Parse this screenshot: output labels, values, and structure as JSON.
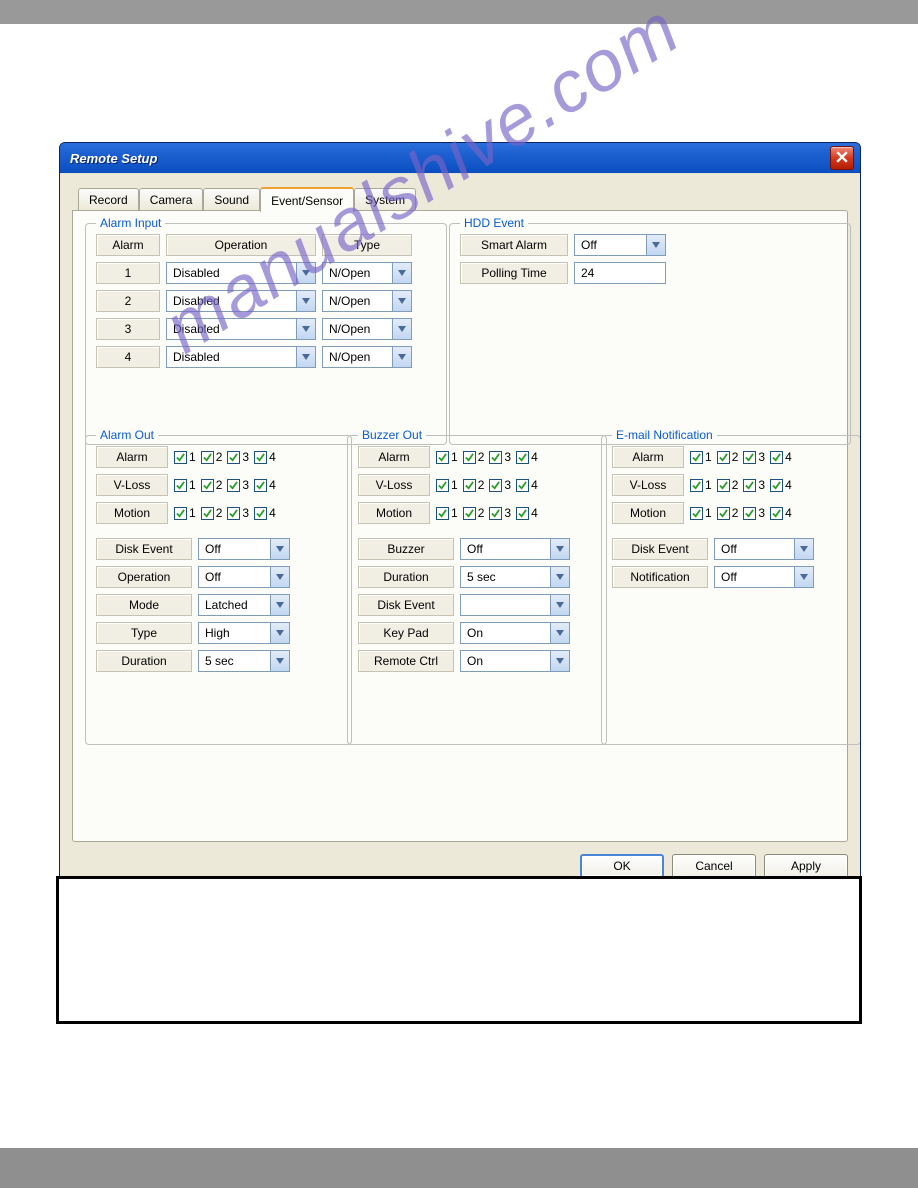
{
  "window": {
    "title": "Remote Setup"
  },
  "tabs": {
    "t0": "Record",
    "t1": "Camera",
    "t2": "Sound",
    "t3": "Event/Sensor",
    "t4": "System"
  },
  "alarm_input": {
    "legend": "Alarm Input",
    "hdr_alarm": "Alarm",
    "hdr_operation": "Operation",
    "hdr_type": "Type",
    "rows": {
      "r1": {
        "num": "1",
        "op": "Disabled",
        "type": "N/Open"
      },
      "r2": {
        "num": "2",
        "op": "Disabled",
        "type": "N/Open"
      },
      "r3": {
        "num": "3",
        "op": "Disabled",
        "type": "N/Open"
      },
      "r4": {
        "num": "4",
        "op": "Disabled",
        "type": "N/Open"
      }
    }
  },
  "hdd_event": {
    "legend": "HDD Event",
    "lbl_smart": "Smart Alarm",
    "val_smart": "Off",
    "lbl_polling": "Polling Time",
    "val_polling": "24"
  },
  "checkbox_labels": {
    "n1": "1",
    "n2": "2",
    "n3": "3",
    "n4": "4"
  },
  "shared_checkrow_labels": {
    "alarm": "Alarm",
    "vloss": "V-Loss",
    "motion": "Motion"
  },
  "alarm_out": {
    "legend": "Alarm Out",
    "settings": {
      "disk_event": {
        "lbl": "Disk Event",
        "val": "Off"
      },
      "operation": {
        "lbl": "Operation",
        "val": "Off"
      },
      "mode": {
        "lbl": "Mode",
        "val": "Latched"
      },
      "type": {
        "lbl": "Type",
        "val": "High"
      },
      "duration": {
        "lbl": "Duration",
        "val": "5 sec"
      }
    }
  },
  "buzzer_out": {
    "legend": "Buzzer Out",
    "settings": {
      "buzzer": {
        "lbl": "Buzzer",
        "val": "Off"
      },
      "duration": {
        "lbl": "Duration",
        "val": "5 sec"
      },
      "disk_event": {
        "lbl": "Disk Event",
        "val": ""
      },
      "keypad": {
        "lbl": "Key Pad",
        "val": "On"
      },
      "remote": {
        "lbl": "Remote Ctrl",
        "val": "On"
      }
    }
  },
  "email": {
    "legend": "E-mail Notification",
    "settings": {
      "disk_event": {
        "lbl": "Disk Event",
        "val": "Off"
      },
      "notification": {
        "lbl": "Notification",
        "val": "Off"
      }
    }
  },
  "buttons": {
    "ok": "OK",
    "cancel": "Cancel",
    "apply": "Apply"
  },
  "watermark": "manualshive.com"
}
